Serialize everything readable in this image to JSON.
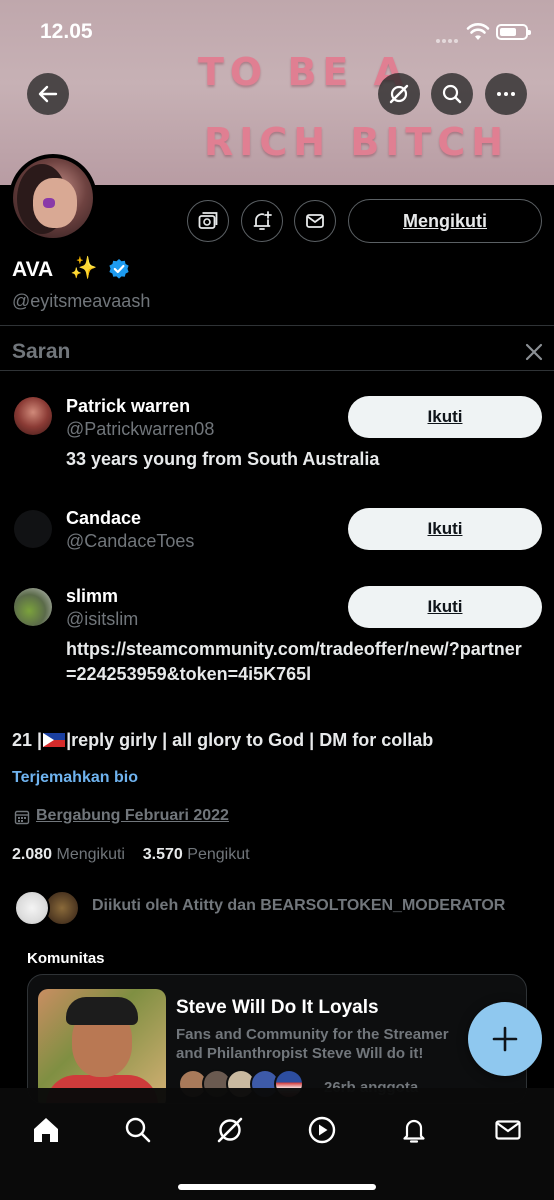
{
  "status_bar": {
    "time": "12.05"
  },
  "banner": {
    "line1": "TO BE A",
    "line2": "RICH BITCH"
  },
  "profile": {
    "display_name": "AVA",
    "sparkle": "✨",
    "handle": "@eyitsmeavaash",
    "follow_label": "Mengikuti",
    "verified_color": "#1d9bf0"
  },
  "suggestions": {
    "title": "Saran",
    "items": [
      {
        "name": "Patrick warren",
        "handle": "@Patrickwarren08",
        "bio": "33 years young from South Australia",
        "button": "Ikuti"
      },
      {
        "name": "Candace",
        "handle": "@CandaceToes",
        "bio": "",
        "button": "Ikuti"
      },
      {
        "name": "slimm",
        "handle": "@isitslim",
        "bio": "https://steamcommunity.com/tradeoffer/new/?partner=224253959&token=4i5K765l",
        "button": "Ikuti"
      }
    ]
  },
  "bio": {
    "prefix": "21 |",
    "suffix": "|reply girly | all glory to God | DM for collab",
    "translate": "Terjemahkan bio",
    "joined": "Bergabung Februari 2022"
  },
  "stats": {
    "following_count": "2.080",
    "following_label": "Mengikuti",
    "followers_count": "3.570",
    "followers_label": "Pengikut"
  },
  "followed_by": "Diikuti oleh Atitty dan BEARSOLTOKEN_MODERATOR",
  "communities": {
    "title": "Komunitas",
    "card": {
      "name": "Steve Will Do It Loyals",
      "description_line1": "Fans and Community for the Streamer",
      "description_line2": "and Philanthropist Steve Will do it!",
      "members": "26rb anggota"
    }
  },
  "colors": {
    "accent": "#1d9bf0",
    "fab": "#8fc8ef",
    "link": "#6fb3ef"
  }
}
